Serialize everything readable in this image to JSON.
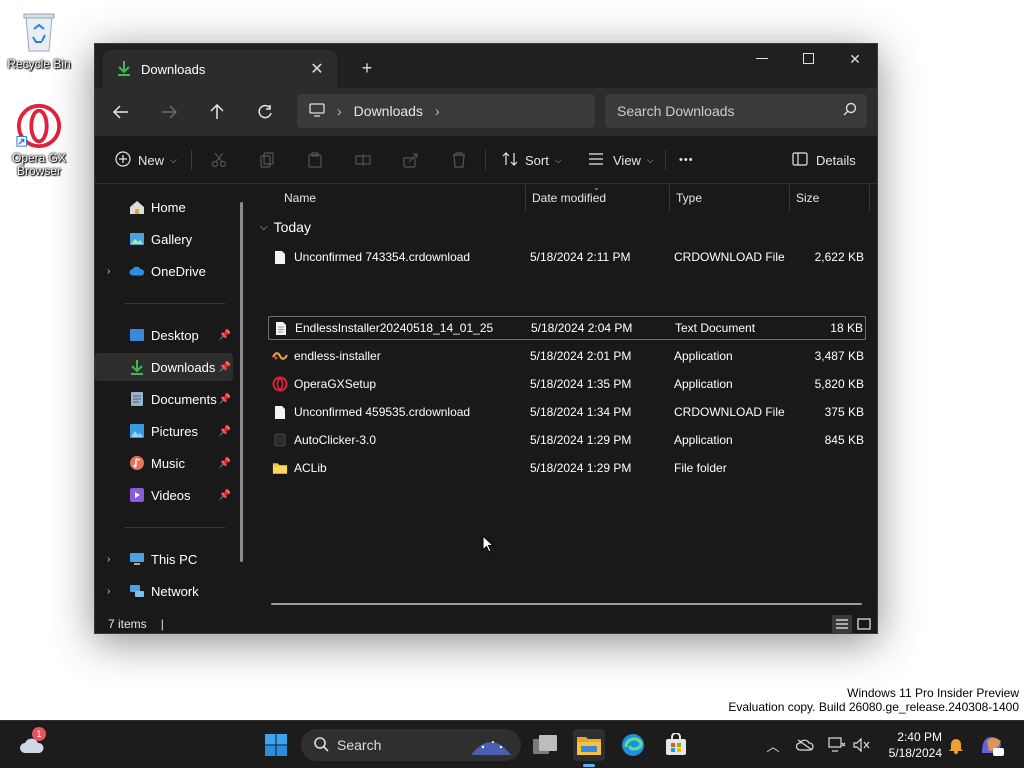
{
  "desktop": {
    "recycle_bin": "Recycle Bin",
    "opera_line1": "Opera GX",
    "opera_line2": "Browser"
  },
  "window": {
    "tab_title": "Downloads",
    "address": {
      "segment": "Downloads"
    },
    "search_placeholder": "Search Downloads",
    "toolbar": {
      "new_label": "New",
      "sort_label": "Sort",
      "view_label": "View",
      "more_label": "•••",
      "details_label": "Details"
    },
    "sidebar": {
      "home": "Home",
      "gallery": "Gallery",
      "onedrive": "OneDrive",
      "desktop": "Desktop",
      "downloads": "Downloads",
      "documents": "Documents",
      "pictures": "Pictures",
      "music": "Music",
      "videos": "Videos",
      "thispc": "This PC",
      "network": "Network"
    },
    "columns": {
      "name": "Name",
      "date": "Date modified",
      "type": "Type",
      "size": "Size"
    },
    "group_label": "Today",
    "files": [
      {
        "name": "Unconfirmed 743354.crdownload",
        "date": "5/18/2024 2:11 PM",
        "type": "CRDOWNLOAD File",
        "size": "2,622 KB",
        "icon": "blank-file-icon"
      },
      {
        "name": "EndlessInstaller20240518_14_01_25",
        "date": "5/18/2024 2:04 PM",
        "type": "Text Document",
        "size": "18 KB",
        "icon": "text-file-icon"
      },
      {
        "name": "endless-installer",
        "date": "5/18/2024 2:01 PM",
        "type": "Application",
        "size": "3,487 KB",
        "icon": "endless-app-icon"
      },
      {
        "name": "OperaGXSetup",
        "date": "5/18/2024 1:35 PM",
        "type": "Application",
        "size": "5,820 KB",
        "icon": "opera-gx-icon"
      },
      {
        "name": "Unconfirmed 459535.crdownload",
        "date": "5/18/2024 1:34 PM",
        "type": "CRDOWNLOAD File",
        "size": "375 KB",
        "icon": "blank-file-icon"
      },
      {
        "name": "AutoClicker-3.0",
        "date": "5/18/2024 1:29 PM",
        "type": "Application",
        "size": "845 KB",
        "icon": "autoclicker-icon"
      },
      {
        "name": "ACLib",
        "date": "5/18/2024 1:29 PM",
        "type": "File folder",
        "size": "",
        "icon": "folder-icon"
      }
    ],
    "status": "7 items"
  },
  "watermark": {
    "line1": "Windows 11 Pro Insider Preview",
    "line2": "Evaluation copy. Build 26080.ge_release.240308-1400"
  },
  "taskbar": {
    "search_label": "Search",
    "weather_badge": "1",
    "time": "2:40 PM",
    "date": "5/18/2024"
  },
  "colors": {
    "window_bg": "#191919",
    "folder": "#f5c342",
    "accent_green": "#3fb950",
    "opera_red": "#e0233d"
  }
}
